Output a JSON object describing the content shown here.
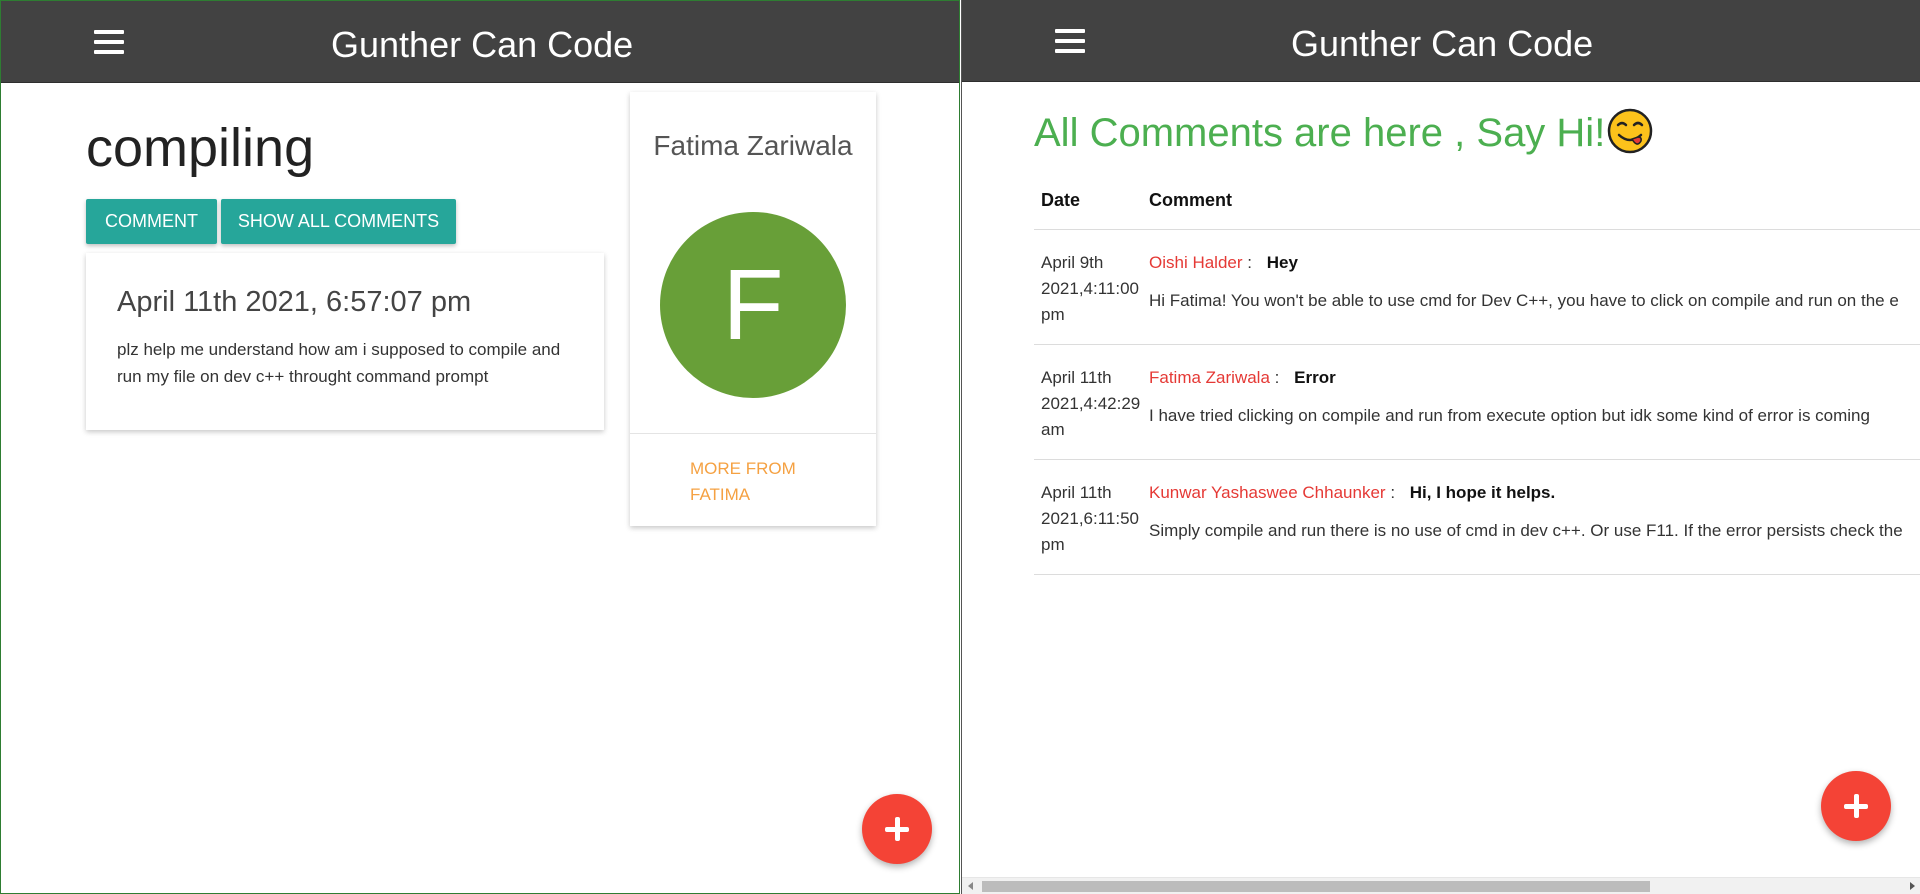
{
  "left": {
    "navbar": {
      "brand": "Gunther Can Code"
    },
    "post": {
      "title": "compiling",
      "comment_button": "COMMENT",
      "show_all_button": "SHOW ALL COMMENTS",
      "date": "April 11th 2021, 6:57:07 pm",
      "body": "plz help me understand how am i supposed to compile and run my file on dev c++ throught command prompt"
    },
    "author": {
      "name": "Fatima Zariwala",
      "initial": "F",
      "more_link": "MORE FROM FATIMA"
    },
    "fab_icon": "plus-icon"
  },
  "right": {
    "navbar": {
      "brand": "Gunther Can Code"
    },
    "heading": "All Comments are here , Say Hi!",
    "heading_emoji": "face-savoring-food-emoji",
    "table": {
      "headers": {
        "date": "Date",
        "comment": "Comment"
      },
      "rows": [
        {
          "date": "April 9th 2021,4:11:00 pm",
          "author": "Oishi Halder",
          "separator": ":",
          "subject": "Hey",
          "text": "Hi Fatima! You won't be able to use cmd for Dev C++, you have to click on compile and run on the e"
        },
        {
          "date": "April 11th 2021,4:42:29 am",
          "author": "Fatima Zariwala",
          "separator": ":",
          "subject": "Error",
          "text": "I have tried clicking on compile and run from execute option but idk some kind of error is coming"
        },
        {
          "date": "April 11th 2021,6:11:50 pm",
          "author": "Kunwar Yashaswee Chhaunker",
          "separator": ":",
          "subject": "Hi, I hope it helps.",
          "text": "Simply compile and run there is no use of cmd in dev c++. Or use F11. If the error persists check the"
        }
      ]
    },
    "fab_icon": "plus-icon"
  },
  "colors": {
    "navbar": "#424242",
    "teal_button": "#26a69a",
    "avatar_green": "#689f38",
    "more_link_orange": "#f5a142",
    "fab_red": "#f44336",
    "heading_green": "#4caf50",
    "author_red": "#e53935"
  }
}
